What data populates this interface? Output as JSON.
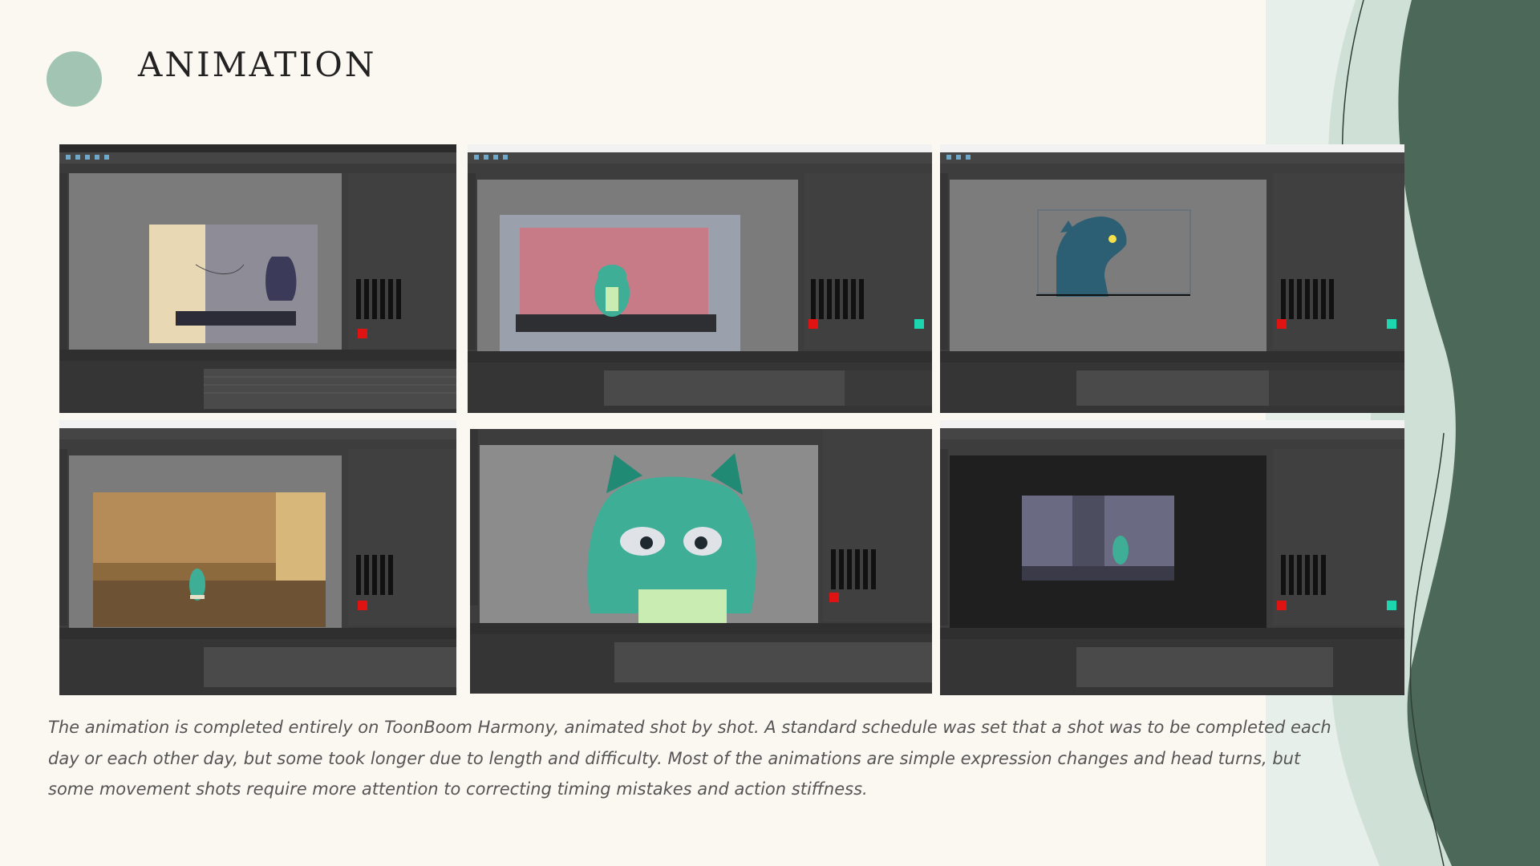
{
  "title": "ANIMATION",
  "caption": "The animation is completed entirely on ToonBoom Harmony, animated shot by shot. A standard schedule was set that a shot was to be completed each day or each other day, but some took longer due to length and difficulty. Most of the animations are simple expression changes and head turns, but some movement shots require more attention to correcting timing mistakes and action stiffness.",
  "colors": {
    "accent_dot": "#a2c4b2",
    "background": "#fbf8f2",
    "dark_green": "#4b6858",
    "app_gray": "#3d3d3d"
  },
  "screenshots": [
    {
      "scene": "room-sketch",
      "icon": "toon-boom-screenshot"
    },
    {
      "scene": "character-at-desk",
      "icon": "toon-boom-screenshot"
    },
    {
      "scene": "dragon-profile",
      "icon": "toon-boom-screenshot"
    },
    {
      "scene": "hallway-walk",
      "icon": "toon-boom-screenshot"
    },
    {
      "scene": "crying-closeup",
      "icon": "toon-boom-screenshot"
    },
    {
      "scene": "doorway-night",
      "icon": "toon-boom-screenshot"
    }
  ]
}
